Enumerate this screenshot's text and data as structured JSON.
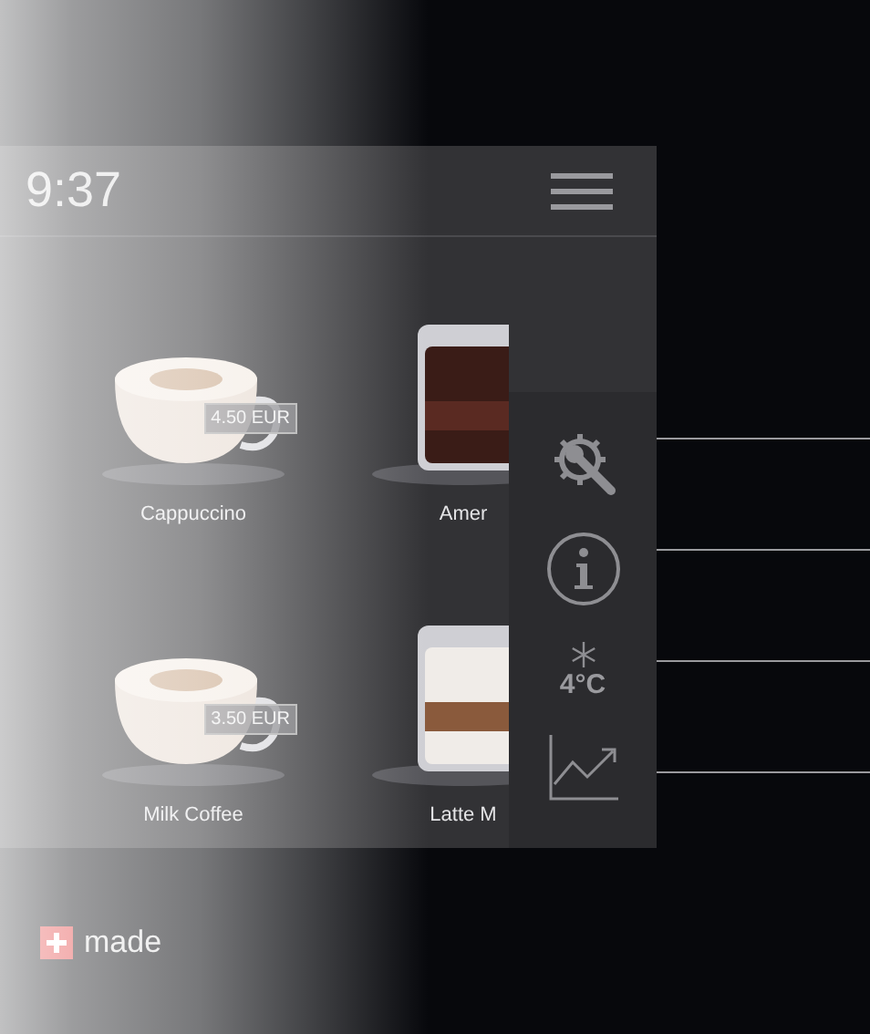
{
  "header": {
    "time": "9:37"
  },
  "drinks": [
    {
      "name": "Cappuccino",
      "price": "4.50 EUR",
      "kind": "cup"
    },
    {
      "name": "Amer",
      "kind": "glass"
    },
    {
      "name": "Milk Coffee",
      "price": "3.50 EUR",
      "kind": "cup"
    },
    {
      "name": "Latte M",
      "kind": "latte"
    }
  ],
  "side_panel": {
    "temperature": "4°C"
  },
  "footer": {
    "brand": "made"
  }
}
